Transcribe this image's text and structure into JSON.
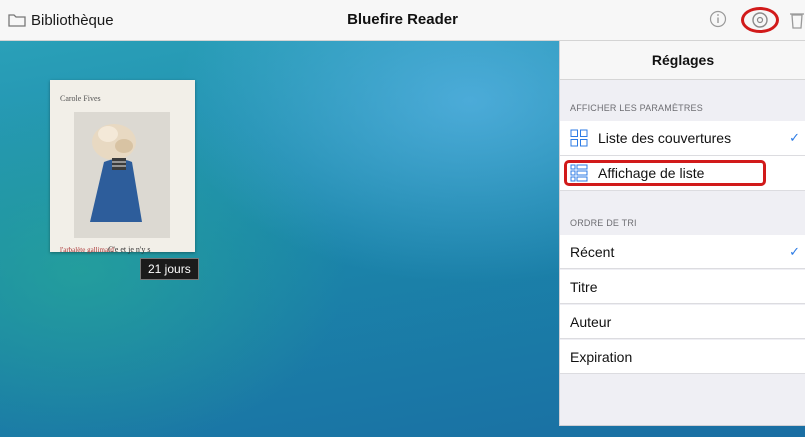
{
  "topbar": {
    "library_label": "Bibliothèque",
    "app_title": "Bluefire Reader"
  },
  "book": {
    "author": "Carole Fives",
    "line_left": "l'arbalète gallimard",
    "line_right": "C'e  et je n'y s",
    "days_badge": "21 jours"
  },
  "settings": {
    "title": "Réglages",
    "display_header": "AFFICHER LES PARAMÈTRES",
    "display_options": [
      {
        "label": "Liste des couvertures",
        "checked": true
      },
      {
        "label": "Affichage de liste",
        "checked": false
      }
    ],
    "sort_header": "ORDRE DE TRI",
    "sort_options": [
      {
        "label": "Récent",
        "checked": true
      },
      {
        "label": "Titre",
        "checked": false
      },
      {
        "label": "Auteur",
        "checked": false
      },
      {
        "label": "Expiration",
        "checked": false
      }
    ],
    "check_mark": "✓"
  },
  "colors": {
    "accent": "#2c7be5",
    "highlight": "#d11a1a",
    "icon_gray": "#9a9a9a"
  },
  "icons": [
    "folder-icon",
    "info-icon",
    "gear-icon",
    "trash-icon",
    "grid-icon",
    "list-icon"
  ]
}
